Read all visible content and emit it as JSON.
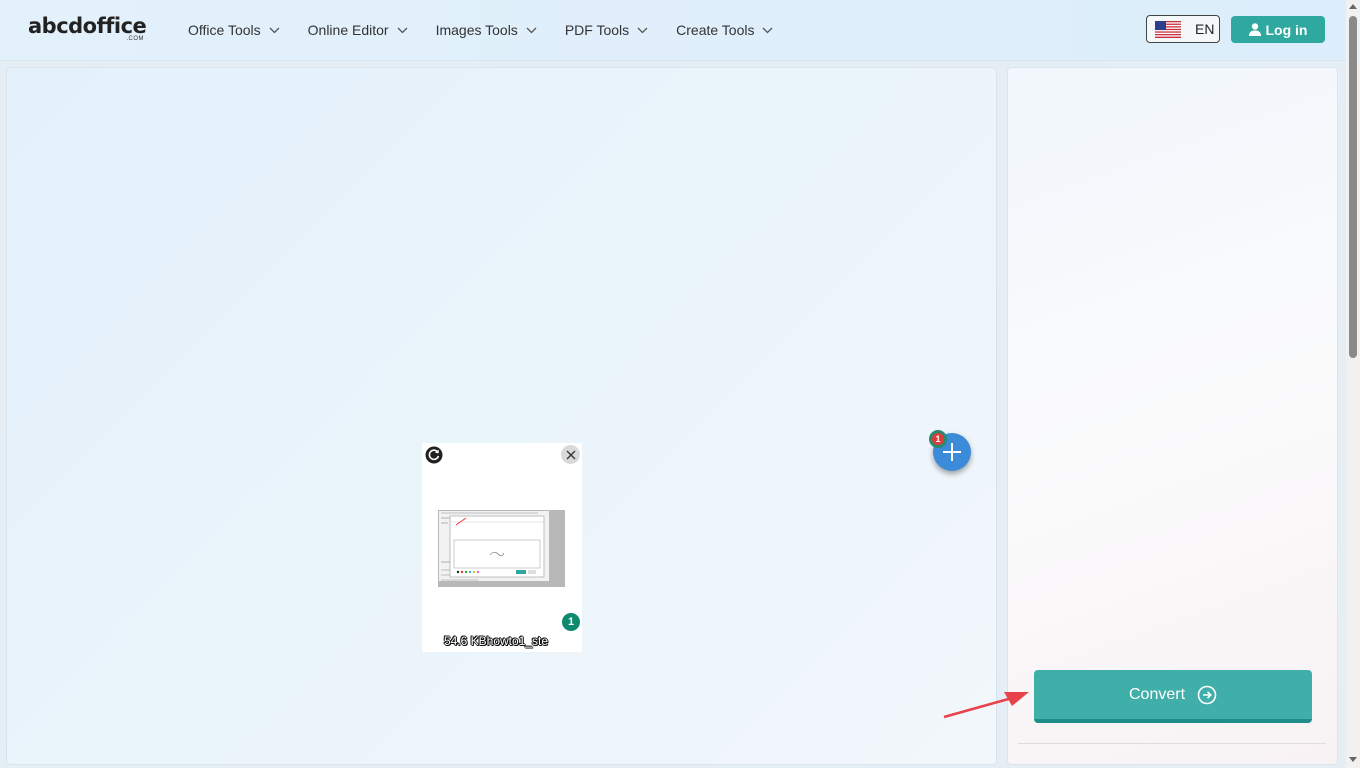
{
  "header": {
    "logo": {
      "text": "abcdoffice",
      "sub": ".COM"
    },
    "nav": [
      {
        "label": "Office Tools"
      },
      {
        "label": "Online Editor"
      },
      {
        "label": "Images Tools"
      },
      {
        "label": "PDF Tools"
      },
      {
        "label": "Create Tools"
      }
    ],
    "language": {
      "code": "EN",
      "flag_icon": "us-flag-icon"
    },
    "login_label": "Log in"
  },
  "upload": {
    "file": {
      "label": "54.6 KBhowto1_ste",
      "badge": "1"
    },
    "add_badge": "1"
  },
  "sidebar": {
    "convert_label": "Convert"
  },
  "colors": {
    "accent": "#2fa9a0",
    "convert": "#40aea9",
    "add_button": "#3b8bd9",
    "badge_green": "#0d8a6e",
    "badge_red": "#e03b3b",
    "arrow": "#e8424a"
  }
}
